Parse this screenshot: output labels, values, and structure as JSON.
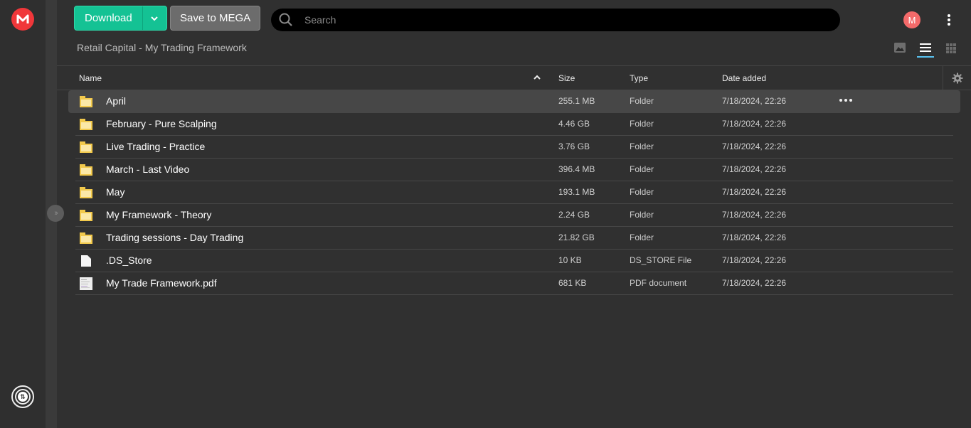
{
  "app": {
    "logo_letter": "M",
    "brand_color": "#f0373a",
    "accent_color": "#14c294"
  },
  "toolbar": {
    "download_label": "Download",
    "save_label": "Save to MEGA",
    "search_placeholder": "Search",
    "search_value": "",
    "avatar_letter": "M"
  },
  "breadcrumb": {
    "path": "Retail Capital - My Trading Framework"
  },
  "view_modes": {
    "options": [
      "thumbnail",
      "list",
      "grid"
    ],
    "active": "list"
  },
  "table": {
    "columns": {
      "name": "Name",
      "size": "Size",
      "type": "Type",
      "date": "Date added"
    },
    "sort": {
      "column": "Name",
      "direction": "ascending"
    },
    "rows": [
      {
        "name": "April",
        "size": "255.1 MB",
        "type": "Folder",
        "date": "7/18/2024, 22:26",
        "icon": "folder-icon",
        "selected": true
      },
      {
        "name": "February - Pure Scalping",
        "size": "4.46 GB",
        "type": "Folder",
        "date": "7/18/2024, 22:26",
        "icon": "folder-icon"
      },
      {
        "name": "Live Trading - Practice",
        "size": "3.76 GB",
        "type": "Folder",
        "date": "7/18/2024, 22:26",
        "icon": "folder-icon"
      },
      {
        "name": "March - Last Video",
        "size": "396.4 MB",
        "type": "Folder",
        "date": "7/18/2024, 22:26",
        "icon": "folder-icon"
      },
      {
        "name": "May",
        "size": "193.1 MB",
        "type": "Folder",
        "date": "7/18/2024, 22:26",
        "icon": "folder-icon"
      },
      {
        "name": "My Framework - Theory",
        "size": "2.24 GB",
        "type": "Folder",
        "date": "7/18/2024, 22:26",
        "icon": "folder-icon"
      },
      {
        "name": "Trading sessions - Day Trading",
        "size": "21.82 GB",
        "type": "Folder",
        "date": "7/18/2024, 22:26",
        "icon": "folder-icon"
      },
      {
        "name": ".DS_Store",
        "size": "10 KB",
        "type": "DS_STORE File",
        "date": "7/18/2024, 22:26",
        "icon": "generic-file-icon"
      },
      {
        "name": "My Trade Framework.pdf",
        "size": "681 KB",
        "type": "PDF document",
        "date": "7/18/2024, 22:26",
        "icon": "pdf-file-icon"
      }
    ]
  }
}
